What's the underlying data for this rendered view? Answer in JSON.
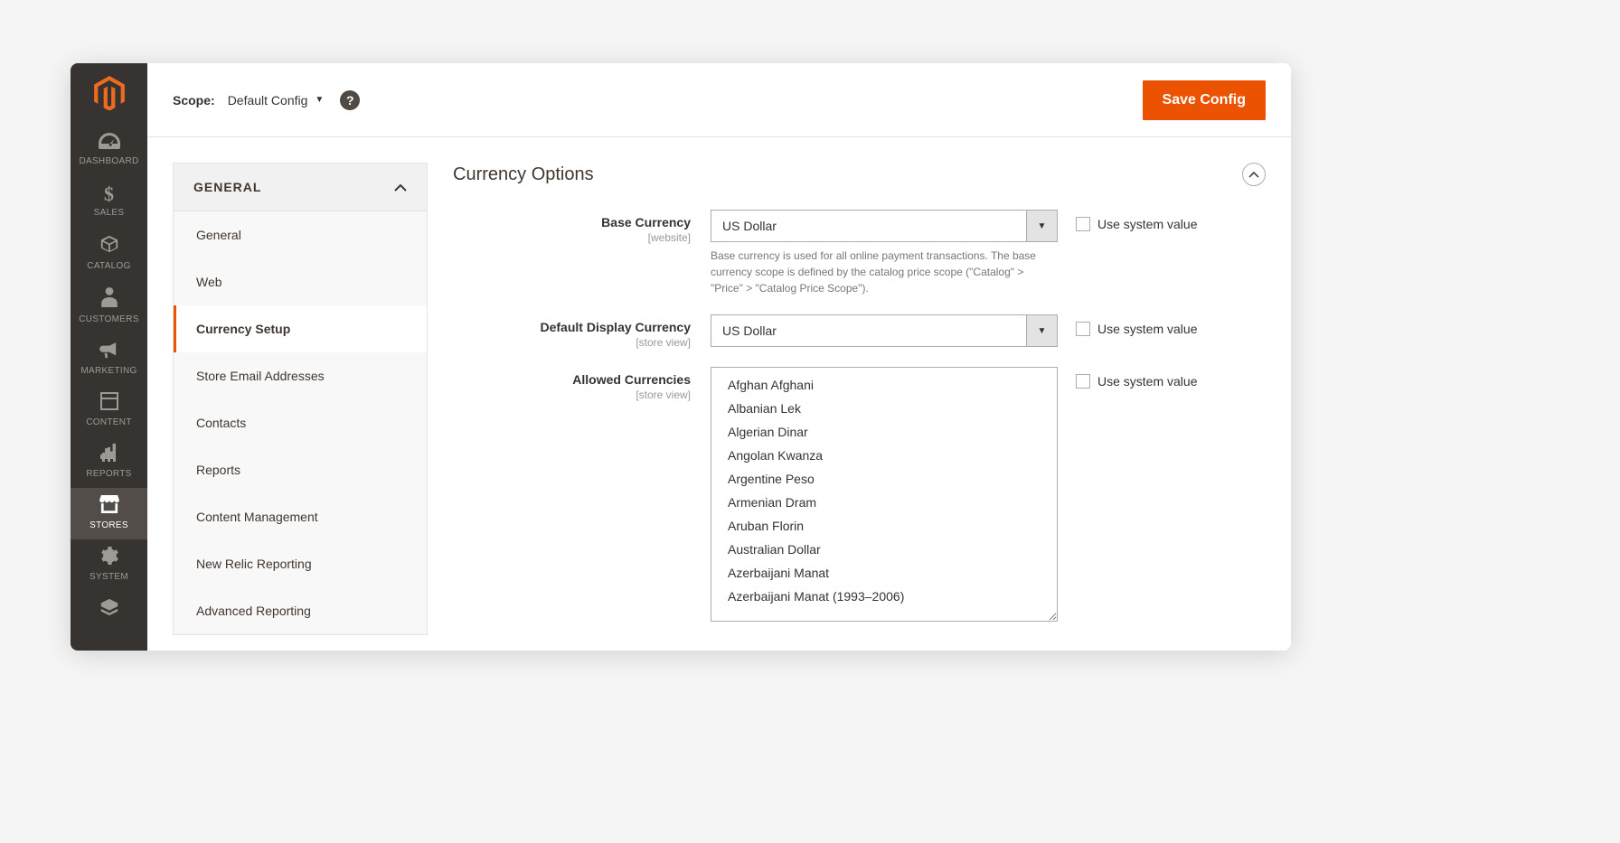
{
  "nav": {
    "items": [
      {
        "label": "DASHBOARD"
      },
      {
        "label": "SALES"
      },
      {
        "label": "CATALOG"
      },
      {
        "label": "CUSTOMERS"
      },
      {
        "label": "MARKETING"
      },
      {
        "label": "CONTENT"
      },
      {
        "label": "REPORTS"
      },
      {
        "label": "STORES"
      },
      {
        "label": "SYSTEM"
      },
      {
        "label": ""
      }
    ]
  },
  "topbar": {
    "scope_label": "Scope:",
    "scope_value": "Default Config",
    "save_label": "Save Config"
  },
  "config_nav": {
    "group_label": "GENERAL",
    "items": [
      "General",
      "Web",
      "Currency Setup",
      "Store Email Addresses",
      "Contacts",
      "Reports",
      "Content Management",
      "New Relic Reporting",
      "Advanced Reporting"
    ],
    "active_index": 2
  },
  "panel": {
    "title": "Currency Options",
    "use_system_value_label": "Use system value",
    "fields": {
      "base_currency": {
        "label": "Base Currency",
        "scope": "[website]",
        "value": "US Dollar",
        "help": "Base currency is used for all online payment transactions. The base currency scope is defined by the catalog price scope (\"Catalog\" > \"Price\" > \"Catalog Price Scope\")."
      },
      "default_display_currency": {
        "label": "Default Display Currency",
        "scope": "[store view]",
        "value": "US Dollar"
      },
      "allowed_currencies": {
        "label": "Allowed Currencies",
        "scope": "[store view]",
        "options": [
          "Afghan Afghani",
          "Albanian Lek",
          "Algerian Dinar",
          "Angolan Kwanza",
          "Argentine Peso",
          "Armenian Dram",
          "Aruban Florin",
          "Australian Dollar",
          "Azerbaijani Manat",
          "Azerbaijani Manat (1993–2006)"
        ]
      }
    }
  }
}
